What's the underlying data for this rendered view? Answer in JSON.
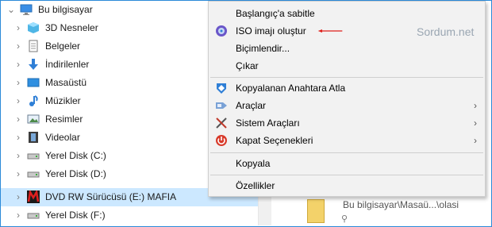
{
  "tree": {
    "root": {
      "label": "Bu bilgisayar",
      "icon": "computer-icon"
    },
    "items": [
      {
        "label": "3D Nesneler",
        "icon": "3d-objects-icon"
      },
      {
        "label": "Belgeler",
        "icon": "documents-icon"
      },
      {
        "label": "İndirilenler",
        "icon": "downloads-icon"
      },
      {
        "label": "Masaüstü",
        "icon": "desktop-icon"
      },
      {
        "label": "Müzikler",
        "icon": "music-icon"
      },
      {
        "label": "Resimler",
        "icon": "pictures-icon"
      },
      {
        "label": "Videolar",
        "icon": "videos-icon"
      },
      {
        "label": "Yerel Disk (C:)",
        "icon": "drive-icon"
      },
      {
        "label": "Yerel Disk (D:)",
        "icon": "drive-icon"
      },
      {
        "label": "DVD RW Sürücüsü (E:) MAFIA",
        "icon": "dvd-drive-icon"
      },
      {
        "label": "Yerel Disk (F:)",
        "icon": "drive-icon"
      }
    ],
    "selected_item": "DVD RW Sürücüsü (E:) MAFIA"
  },
  "context_menu": {
    "items": [
      {
        "label": "Başlangıç'a sabitle"
      },
      {
        "label": "ISO imajı oluştur",
        "icon": "iso-maker-icon"
      },
      {
        "label": "Biçimlendir..."
      },
      {
        "label": "Çıkar"
      },
      {
        "label": "Kopyalanan Anahtara Atla",
        "icon": "keyfolder-icon"
      },
      {
        "label": "Araçlar",
        "icon": "tools-icon",
        "submenu": true
      },
      {
        "label": "Sistem Araçları",
        "icon": "system-tools-icon",
        "submenu": true
      },
      {
        "label": "Kapat Seçenekleri",
        "icon": "power-icon",
        "submenu": true
      },
      {
        "label": "Kopyala"
      },
      {
        "label": "Özellikler"
      }
    ]
  },
  "watermark": "Sordum.net",
  "content": {
    "path_text": "Bu bilgisayar\\Masaü...\\olasi"
  },
  "colors": {
    "selection": "#cce8ff",
    "window_border": "#2b8ad8",
    "menu_bg": "#f2f2f2",
    "arrow": "#e0201b"
  }
}
